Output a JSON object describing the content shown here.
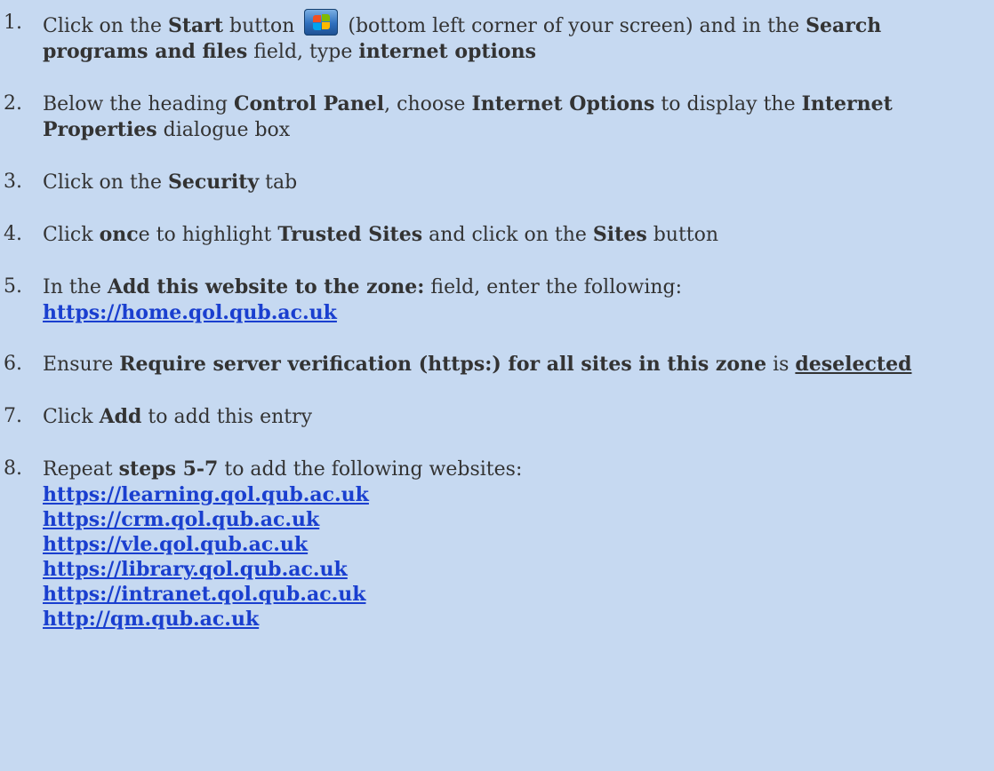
{
  "steps": [
    {
      "num": "1.",
      "t1": "Click on the ",
      "b1": "Start",
      "t2": " button ",
      "icon": "windows-start-orb-icon",
      "t3": " (bottom left corner of your screen) and in the ",
      "b2": "Search",
      "b3": "programs and files",
      "t4": " field, type ",
      "b4": "internet options"
    },
    {
      "num": "2.",
      "t1": "Below the heading ",
      "b1": "Control Panel",
      "t2": ", choose ",
      "b2": "Internet Options",
      "t3": " to display the ",
      "b3": "Internet",
      "b4": "Properties",
      "t4": " dialogue box"
    },
    {
      "num": "3.",
      "t1": "Click on the ",
      "b1": "Security",
      "t2": " tab"
    },
    {
      "num": "4.",
      "t1": "Click ",
      "b1": "onc",
      "t2": "e to highlight ",
      "b2": "Trusted Sites",
      "t3": " and click on the ",
      "b3": "Sites",
      "t4": " button"
    },
    {
      "num": "5.",
      "t1": "In the ",
      "b1": "Add this website to the zone:",
      "t2": " field, enter the following:",
      "link": "https://home.qol.qub.ac.uk"
    },
    {
      "num": "6.",
      "t1": "Ensure ",
      "b1": "Require server verification (https:) for all sites in this zone",
      "t2": " is ",
      "b2": "deselected"
    },
    {
      "num": "7.",
      "t1": "Click ",
      "b1": "Add",
      "t2": " to add this entry"
    },
    {
      "num": "8.",
      "t1": "Repeat ",
      "b1": "steps 5-7",
      "t2": " to add the following websites:",
      "links": [
        "https://learning.qol.qub.ac.uk",
        "https://crm.qol.qub.ac.uk",
        "https://vle.qol.qub.ac.uk",
        "https://library.qol.qub.ac.uk",
        "https://intranet.qol.qub.ac.uk",
        "http://qm.qub.ac.uk"
      ]
    }
  ],
  "colors": {
    "background": "#c6d9f1",
    "text": "#333333",
    "link": "#1a3fcf"
  }
}
